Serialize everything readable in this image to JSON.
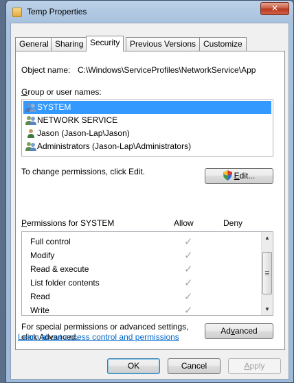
{
  "window": {
    "title": "Temp Properties",
    "close_icon": "close-icon"
  },
  "tabs": [
    {
      "label": "General",
      "active": false
    },
    {
      "label": "Sharing",
      "active": false
    },
    {
      "label": "Security",
      "active": true
    },
    {
      "label": "Previous Versions",
      "active": false
    },
    {
      "label": "Customize",
      "active": false
    }
  ],
  "object": {
    "label": "Object name:",
    "value": "C:\\Windows\\ServiceProfiles\\NetworkService\\App"
  },
  "groups": {
    "label_prefix": "",
    "label_accel": "G",
    "label_rest": "roup or user names:",
    "items": [
      {
        "name": "SYSTEM",
        "icon": "group-users-icon",
        "selected": true
      },
      {
        "name": "NETWORK SERVICE",
        "icon": "group-users-icon",
        "selected": false
      },
      {
        "name": "Jason (Jason-Lap\\Jason)",
        "icon": "user-icon",
        "selected": false
      },
      {
        "name": "Administrators (Jason-Lap\\Administrators)",
        "icon": "group-users-icon",
        "selected": false
      }
    ]
  },
  "change": {
    "text": "To change permissions, click Edit.",
    "edit_accel": "E",
    "edit_rest": "dit...",
    "edit_icon": "uac-shield-icon"
  },
  "permissions": {
    "label_accel": "P",
    "label_rest": "ermissions for SYSTEM",
    "allow_header": "Allow",
    "deny_header": "Deny",
    "check_glyph": "✓",
    "rows": [
      {
        "name": "Full control",
        "allow": true,
        "deny": false
      },
      {
        "name": "Modify",
        "allow": true,
        "deny": false
      },
      {
        "name": "Read & execute",
        "allow": true,
        "deny": false
      },
      {
        "name": "List folder contents",
        "allow": true,
        "deny": false
      },
      {
        "name": "Read",
        "allow": true,
        "deny": false
      },
      {
        "name": "Write",
        "allow": true,
        "deny": false
      }
    ]
  },
  "advanced": {
    "line1": "For special permissions or advanced settings,",
    "line2": "click Advanced.",
    "button_pre": "Ad",
    "button_accel": "v",
    "button_post": "anced"
  },
  "help_link": "Learn about access control and permissions",
  "footer": {
    "ok": "OK",
    "cancel": "Cancel",
    "apply_accel": "A",
    "apply_rest": "pply"
  }
}
